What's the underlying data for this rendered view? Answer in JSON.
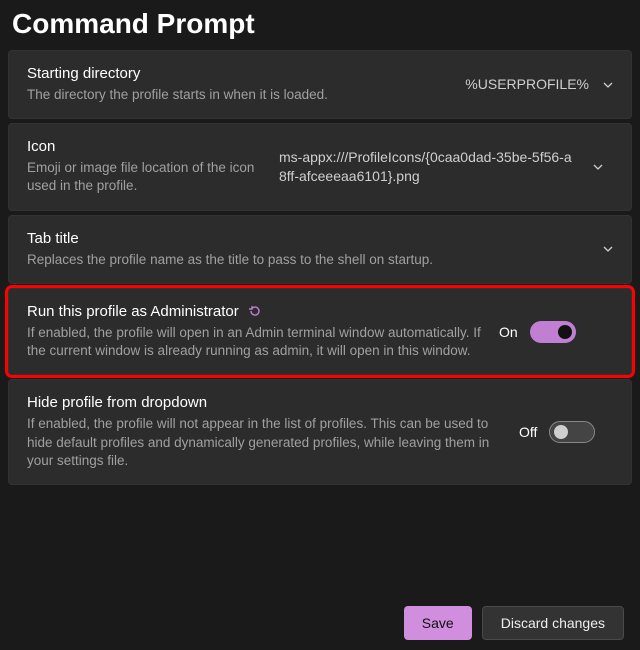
{
  "page_title": "Command Prompt",
  "rows": {
    "starting_dir": {
      "title": "Starting directory",
      "desc": "The directory the profile starts in when it is loaded.",
      "value": "%USERPROFILE%"
    },
    "icon": {
      "title": "Icon",
      "desc": "Emoji or image file location of the icon used in the profile.",
      "value": "ms-appx:///ProfileIcons/{0caa0dad-35be-5f56-a8ff-afceeeaa6101}.png"
    },
    "tab_title": {
      "title": "Tab title",
      "desc": "Replaces the profile name as the title to pass to the shell on startup."
    },
    "run_admin": {
      "title": "Run this profile as Administrator",
      "desc": "If enabled, the profile will open in an Admin terminal window automatically. If the current window is already running as admin, it will open in this window.",
      "state_label": "On"
    },
    "hide_profile": {
      "title": "Hide profile from dropdown",
      "desc": "If enabled, the profile will not appear in the list of profiles. This can be used to hide default profiles and dynamically generated profiles, while leaving them in your settings file.",
      "state_label": "Off"
    }
  },
  "buttons": {
    "save": "Save",
    "discard": "Discard changes"
  },
  "colors": {
    "accent": "#c17fd4",
    "highlight_border": "#ff0000"
  }
}
